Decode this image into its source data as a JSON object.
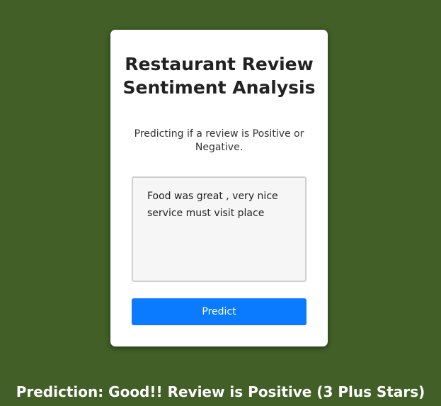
{
  "card": {
    "title": "Restaurant Review Sentiment Analysis",
    "subtitle": "Predicting if a review is Positive or Negative.",
    "review_value": "Food was great , very nice service must visit place",
    "predict_label": "Predict"
  },
  "result": {
    "prediction_text": "Prediction: Good!! Review is Positive (3 Plus Stars)"
  },
  "colors": {
    "background": "#415f27",
    "card": "#ffffff",
    "button": "#0a7bff",
    "button_text": "#ffffff"
  }
}
